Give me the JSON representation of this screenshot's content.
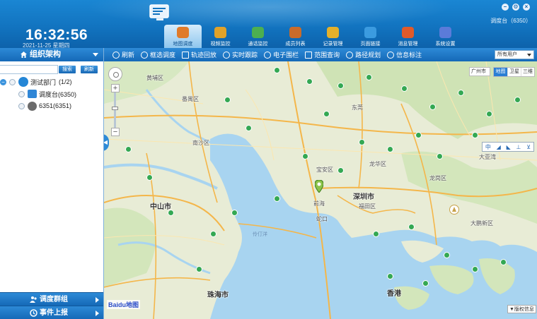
{
  "header": {
    "time": "16:32:56",
    "date": "2021-11-25 星期四",
    "user": "调度台（6350）",
    "window_controls": [
      "minimize-icon",
      "gear-icon",
      "close-icon"
    ]
  },
  "nav": {
    "tabs": [
      {
        "label": "地图调度",
        "icon": "map-dispatch-icon",
        "color": "#e07b2a",
        "active": true
      },
      {
        "label": "视频监控",
        "icon": "video-monitor-icon",
        "color": "#e0a22a",
        "active": false
      },
      {
        "label": "通话监控",
        "icon": "call-monitor-icon",
        "color": "#4caf50",
        "active": false
      },
      {
        "label": "成员列表",
        "icon": "member-list-icon",
        "color": "#c96b2a",
        "active": false
      },
      {
        "label": "记录管理",
        "icon": "record-manage-icon",
        "color": "#e3b02b",
        "active": false
      },
      {
        "label": "页面链接",
        "icon": "page-link-icon",
        "color": "#3b9be0",
        "active": false
      },
      {
        "label": "消息管理",
        "icon": "message-manage-icon",
        "color": "#e05a2a",
        "active": false
      },
      {
        "label": "系统设置",
        "icon": "system-settings-icon",
        "color": "#5b7bd9",
        "active": false
      }
    ]
  },
  "left_panel": {
    "title": "组织架构",
    "search": {
      "value": "",
      "placeholder": ""
    },
    "search_btn": "搜索",
    "refresh_btn": "刷新",
    "tree": {
      "dept": "测试部门",
      "dept_count": "(1/2)",
      "members": [
        {
          "label": "调度台(6350)",
          "type": "pc"
        },
        {
          "label": "6351(6351)",
          "type": "user"
        }
      ]
    },
    "bottom_menus": [
      {
        "label": "调度群组",
        "icon": "group-icon"
      },
      {
        "label": "事件上报",
        "icon": "event-report-icon"
      }
    ]
  },
  "toolbar": {
    "items": [
      {
        "label": "刷新",
        "icon": "refresh-icon"
      },
      {
        "label": "框选调度",
        "icon": "box-select-icon"
      },
      {
        "label": "轨迹回放",
        "icon": "track-playback-icon"
      },
      {
        "label": "实时跟踪",
        "icon": "realtime-track-icon"
      },
      {
        "label": "电子围栏",
        "icon": "fence-icon"
      },
      {
        "label": "范围查询",
        "icon": "range-query-icon"
      },
      {
        "label": "路径规划",
        "icon": "route-plan-icon"
      },
      {
        "label": "信息标注",
        "icon": "info-mark-icon"
      }
    ],
    "user_filter": "所有用户"
  },
  "map": {
    "city_select": "广州市",
    "map_types": [
      {
        "label": "地图",
        "active": true
      },
      {
        "label": "卫星",
        "active": false
      },
      {
        "label": "三维",
        "active": false
      }
    ],
    "tools": [
      "中",
      "◢",
      "◣",
      "⊥",
      "⊻"
    ],
    "provider_logo": "Baidu地图",
    "copyright": "▼版权信息",
    "labels": {
      "zhongshan": "中山市",
      "shenzhen": "深圳市",
      "zhuhai": "珠海市",
      "hongkong": "香港",
      "dongguan": "东莞",
      "panyu": "番禺区",
      "nansha": "南沙区",
      "huangpu": "黄埔区",
      "baoan": "宝安区",
      "longgang": "龙岗区",
      "huizhou_bay": "大亚湾",
      "qianhai": "前海",
      "lingding": "伶仃洋",
      "shekou": "蛇口",
      "longhua": "龙华区",
      "futian": "福田区",
      "daya": "大鹏新区"
    }
  },
  "colors": {
    "brand_blue": "#1274c0",
    "accent": "#2a7ed4",
    "sea": "#a8d4f0",
    "land": "#e8ecd6"
  }
}
